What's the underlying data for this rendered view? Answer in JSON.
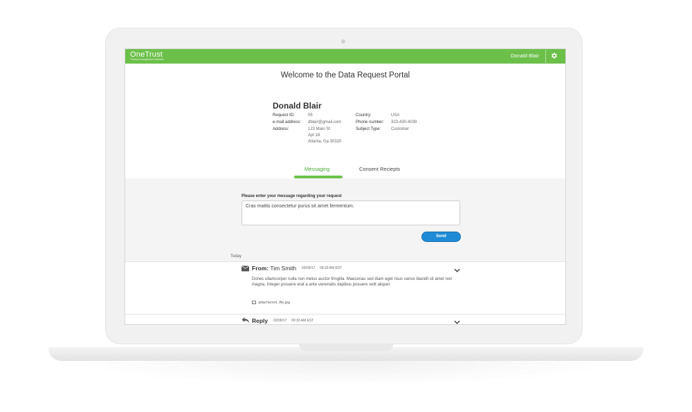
{
  "header": {
    "logo": "OneTrust",
    "logo_subtitle": "Privacy management Software",
    "user_name": "Donald Blair",
    "settings_icon": "gear-icon",
    "bar_color": "#6cc04a"
  },
  "portal_title": "Welcome to the Data Request Portal",
  "profile": {
    "name": "Donald Blair",
    "left_fields": [
      {
        "label": "Request ID:",
        "value": "05"
      },
      {
        "label": "e-mail address:",
        "value": "dblair@gmail.com"
      },
      {
        "label": "Address:",
        "value": "123 Main St"
      }
    ],
    "address_lines": [
      "Apt 18",
      "Atlanta, Ga 30320"
    ],
    "right_fields": [
      {
        "label": "Country:",
        "value": "USA"
      },
      {
        "label": "Phone number:",
        "value": "323-430-4039"
      },
      {
        "label": "Subject Type:",
        "value": "Customer"
      }
    ]
  },
  "tabs": [
    {
      "label": "Messaging",
      "active": true
    },
    {
      "label": "Consent Reciepts",
      "active": false
    }
  ],
  "compose": {
    "prompt": "Please enter your message regarding your request",
    "value": "Cras mattis consectetur purus sit amet fermentum.",
    "send_label": "Send",
    "send_color": "#1f8bd6"
  },
  "day_label": "Today",
  "messages": [
    {
      "icon": "envelope-icon",
      "prefix": "From:",
      "sender": "Tim Smith",
      "date": "03/09/17",
      "time": "09:33 AM EST",
      "body": "Donec ullamcorper nulla non metus auctor fringilla. Maecenas sed diam eget risus varius blandit sit amet non magna. Integer posuere erat a ante venenatis dapibus posuere velit aliquet.",
      "attachment": "attachemnt_file.jpg"
    },
    {
      "icon": "reply-icon",
      "prefix": "Reply",
      "date": "03/09/17",
      "time": "09:33 AM EST"
    }
  ]
}
